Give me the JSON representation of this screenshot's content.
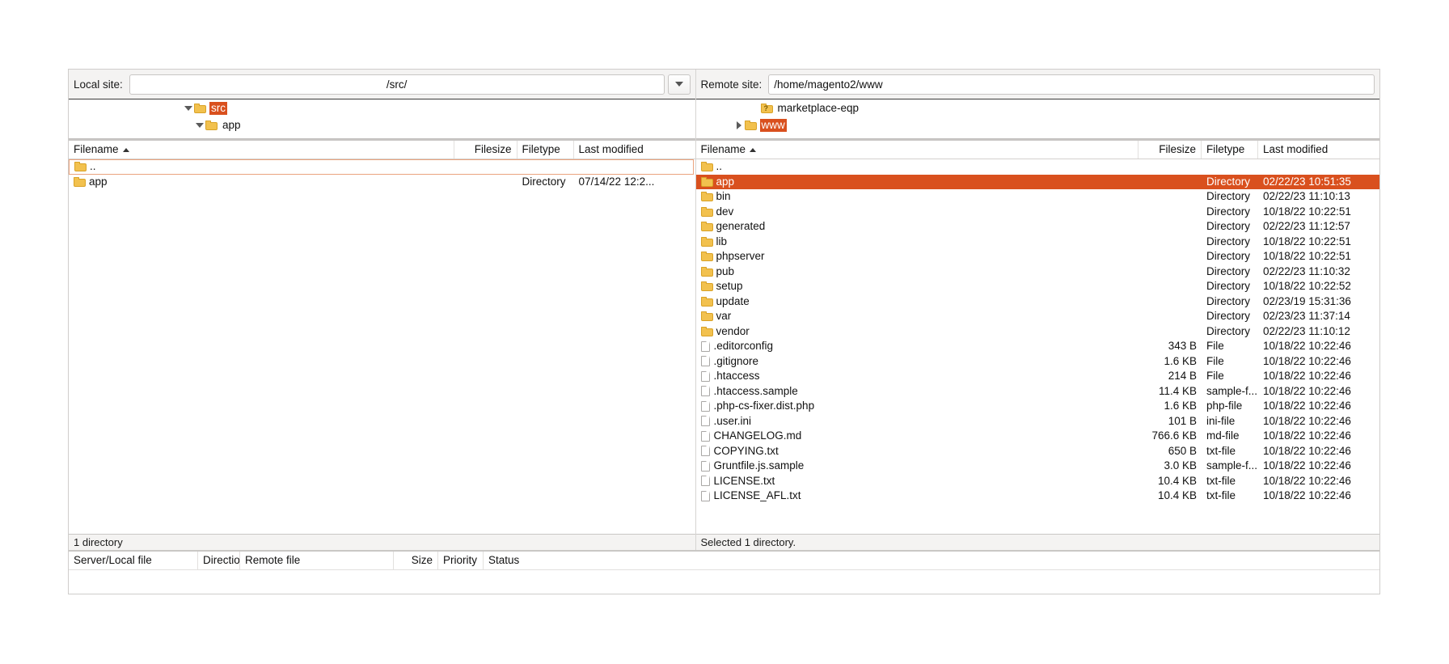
{
  "local": {
    "site_label": "Local site:",
    "path_value": "/src/",
    "combo_icon": "chevron-down-icon",
    "tree": [
      {
        "name": "src",
        "twisty": "down",
        "indent": 1,
        "selected": true,
        "icon": "folder-icon"
      },
      {
        "name": "app",
        "twisty": "down",
        "indent": 2,
        "selected": false,
        "icon": "folder-icon"
      }
    ],
    "columns": {
      "filename": "Filename",
      "filesize": "Filesize",
      "filetype": "Filetype",
      "last_modified": "Last modified",
      "sort_icon": "sort-ascending-icon"
    },
    "rows": [
      {
        "name": "..",
        "icon": "folder-icon",
        "size": "",
        "type": "",
        "modified": "",
        "selected": false,
        "focused": true
      },
      {
        "name": "app",
        "icon": "folder-icon",
        "size": "",
        "type": "Directory",
        "modified": "07/14/22 12:2...",
        "selected": false,
        "focused": false
      }
    ],
    "status": "1 directory"
  },
  "remote": {
    "site_label": "Remote site:",
    "path_value": "/home/magento2/www",
    "tree": [
      {
        "name": "marketplace-eqp",
        "twisty": "none",
        "indent": 1,
        "selected": false,
        "icon": "folder-unknown-icon"
      },
      {
        "name": "www",
        "twisty": "right",
        "indent": 1,
        "selected": true,
        "icon": "folder-icon"
      }
    ],
    "columns": {
      "filename": "Filename",
      "filesize": "Filesize",
      "filetype": "Filetype",
      "last_modified": "Last modified",
      "sort_icon": "sort-ascending-icon"
    },
    "rows": [
      {
        "name": "..",
        "icon": "folder-icon",
        "size": "",
        "type": "",
        "modified": "",
        "selected": false
      },
      {
        "name": "app",
        "icon": "folder-icon",
        "size": "",
        "type": "Directory",
        "modified": "02/22/23 10:51:35",
        "selected": true
      },
      {
        "name": "bin",
        "icon": "folder-icon",
        "size": "",
        "type": "Directory",
        "modified": "02/22/23 11:10:13",
        "selected": false
      },
      {
        "name": "dev",
        "icon": "folder-icon",
        "size": "",
        "type": "Directory",
        "modified": "10/18/22 10:22:51",
        "selected": false
      },
      {
        "name": "generated",
        "icon": "folder-icon",
        "size": "",
        "type": "Directory",
        "modified": "02/22/23 11:12:57",
        "selected": false
      },
      {
        "name": "lib",
        "icon": "folder-icon",
        "size": "",
        "type": "Directory",
        "modified": "10/18/22 10:22:51",
        "selected": false
      },
      {
        "name": "phpserver",
        "icon": "folder-icon",
        "size": "",
        "type": "Directory",
        "modified": "10/18/22 10:22:51",
        "selected": false
      },
      {
        "name": "pub",
        "icon": "folder-icon",
        "size": "",
        "type": "Directory",
        "modified": "02/22/23 11:10:32",
        "selected": false
      },
      {
        "name": "setup",
        "icon": "folder-icon",
        "size": "",
        "type": "Directory",
        "modified": "10/18/22 10:22:52",
        "selected": false
      },
      {
        "name": "update",
        "icon": "folder-icon",
        "size": "",
        "type": "Directory",
        "modified": "02/23/19 15:31:36",
        "selected": false
      },
      {
        "name": "var",
        "icon": "folder-icon",
        "size": "",
        "type": "Directory",
        "modified": "02/23/23 11:37:14",
        "selected": false
      },
      {
        "name": "vendor",
        "icon": "folder-icon",
        "size": "",
        "type": "Directory",
        "modified": "02/22/23 11:10:12",
        "selected": false
      },
      {
        "name": ".editorconfig",
        "icon": "file-icon",
        "size": "343 B",
        "type": "File",
        "modified": "10/18/22 10:22:46",
        "selected": false
      },
      {
        "name": ".gitignore",
        "icon": "file-icon",
        "size": "1.6 KB",
        "type": "File",
        "modified": "10/18/22 10:22:46",
        "selected": false
      },
      {
        "name": ".htaccess",
        "icon": "file-icon",
        "size": "214 B",
        "type": "File",
        "modified": "10/18/22 10:22:46",
        "selected": false
      },
      {
        "name": ".htaccess.sample",
        "icon": "file-icon",
        "size": "11.4 KB",
        "type": "sample-f...",
        "modified": "10/18/22 10:22:46",
        "selected": false
      },
      {
        "name": ".php-cs-fixer.dist.php",
        "icon": "file-icon",
        "size": "1.6 KB",
        "type": "php-file",
        "modified": "10/18/22 10:22:46",
        "selected": false
      },
      {
        "name": ".user.ini",
        "icon": "file-icon",
        "size": "101 B",
        "type": "ini-file",
        "modified": "10/18/22 10:22:46",
        "selected": false
      },
      {
        "name": "CHANGELOG.md",
        "icon": "file-icon",
        "size": "766.6 KB",
        "type": "md-file",
        "modified": "10/18/22 10:22:46",
        "selected": false
      },
      {
        "name": "COPYING.txt",
        "icon": "file-icon",
        "size": "650 B",
        "type": "txt-file",
        "modified": "10/18/22 10:22:46",
        "selected": false
      },
      {
        "name": "Gruntfile.js.sample",
        "icon": "file-icon",
        "size": "3.0 KB",
        "type": "sample-f...",
        "modified": "10/18/22 10:22:46",
        "selected": false
      },
      {
        "name": "LICENSE.txt",
        "icon": "file-icon",
        "size": "10.4 KB",
        "type": "txt-file",
        "modified": "10/18/22 10:22:46",
        "selected": false
      },
      {
        "name": "LICENSE_AFL.txt",
        "icon": "file-icon",
        "size": "10.4 KB",
        "type": "txt-file",
        "modified": "10/18/22 10:22:46",
        "selected": false
      }
    ],
    "status": "Selected 1 directory."
  },
  "queue": {
    "columns": {
      "server_local_file": "Server/Local file",
      "direction": "Directio",
      "remote_file": "Remote file",
      "size": "Size",
      "priority": "Priority",
      "status": "Status"
    },
    "rows": []
  },
  "colors": {
    "selection": "#d9501e",
    "folder": "#f2c14e",
    "focus_outline": "#eaa37e",
    "chrome": "#f4f3f2"
  }
}
